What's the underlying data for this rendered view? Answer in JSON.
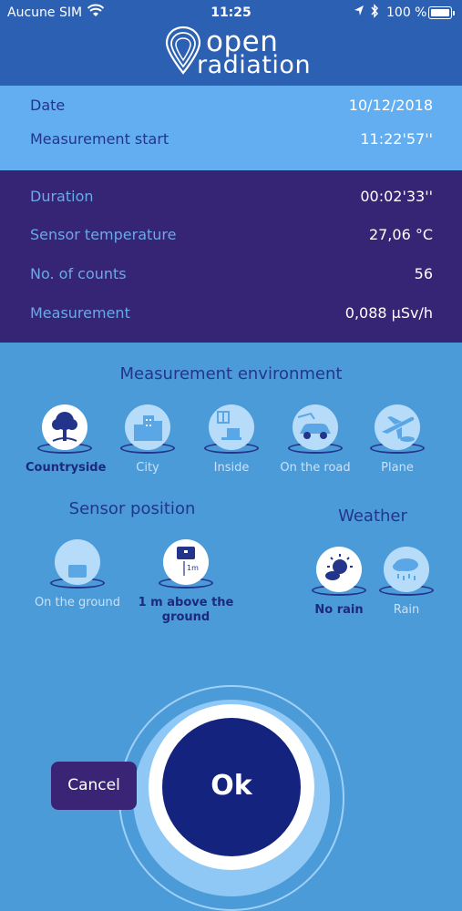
{
  "status": {
    "carrier": "Aucune SIM",
    "time": "11:25",
    "battery": "100 %"
  },
  "app": {
    "logo_top": "open",
    "logo_bottom": "radiation"
  },
  "measure": {
    "date_label": "Date",
    "date_value": "10/12/2018",
    "start_label": "Measurement start",
    "start_value": "11:22'57''",
    "duration_label": "Duration",
    "duration_value": "00:02'33''",
    "temp_label": "Sensor temperature",
    "temp_value": "27,06  °C",
    "counts_label": "No. of counts",
    "counts_value": "56",
    "meas_label": "Measurement",
    "meas_value": "0,088  µSv/h"
  },
  "environment": {
    "title": "Measurement environment",
    "options": [
      {
        "label": "Countryside",
        "selected": true
      },
      {
        "label": "City",
        "selected": false
      },
      {
        "label": "Inside",
        "selected": false
      },
      {
        "label": "On the road",
        "selected": false
      },
      {
        "label": "Plane",
        "selected": false
      }
    ]
  },
  "sensor": {
    "title": "Sensor position",
    "options": [
      {
        "label": "On the ground",
        "selected": false
      },
      {
        "label": "1 m above the ground",
        "selected": true
      }
    ]
  },
  "weather": {
    "title": "Weather",
    "options": [
      {
        "label": "No rain",
        "selected": true
      },
      {
        "label": "Rain",
        "selected": false
      }
    ]
  },
  "actions": {
    "ok": "Ok",
    "cancel": "Cancel"
  },
  "colors": {
    "header": "#2c60b3",
    "panel_light": "#62aef0",
    "panel_dark": "#362474",
    "background": "#4c9bd9",
    "accent": "#14237d"
  }
}
